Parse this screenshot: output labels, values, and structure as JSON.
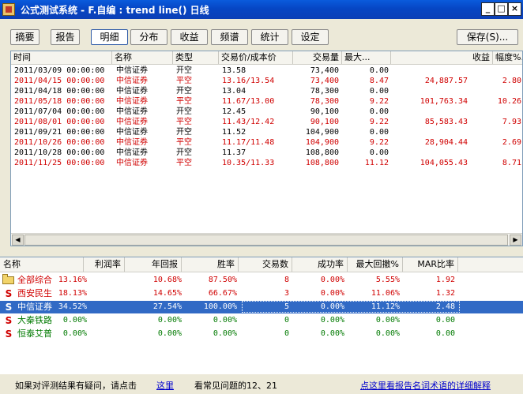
{
  "window": {
    "title": "公式测试系统 - F.自编 : trend line() 日线",
    "minimize": "_",
    "maximize": "□",
    "close": "×"
  },
  "tabs": [
    {
      "label": "摘要",
      "active": false
    },
    {
      "label": "报告",
      "active": false
    },
    {
      "label": "明细",
      "active": true
    },
    {
      "label": "分布",
      "active": false
    },
    {
      "label": "收益",
      "active": false
    },
    {
      "label": "频谱",
      "active": false
    },
    {
      "label": "统计",
      "active": false
    },
    {
      "label": "设定",
      "active": false
    }
  ],
  "save_label": "保存(S)...",
  "detail": {
    "columns": [
      "时间",
      "名称",
      "类型",
      "交易价/成本价",
      "交易量",
      "最大...",
      "收益",
      "幅度%..."
    ],
    "rows": [
      {
        "time": "2011/03/09 00:00:00",
        "name": "中信证券",
        "type": "开空",
        "price": "13.58",
        "volume": "73,400",
        "max": "0.00",
        "profit": "",
        "range": "",
        "red": false
      },
      {
        "time": "2011/04/15 00:00:00",
        "name": "中信证券",
        "type": "平空",
        "price": "13.16/13.54",
        "volume": "73,400",
        "max": "8.47",
        "profit": "24,887.57",
        "range": "2.80",
        "red": true
      },
      {
        "time": "2011/04/18 00:00:00",
        "name": "中信证券",
        "type": "开空",
        "price": "13.04",
        "volume": "78,300",
        "max": "0.00",
        "profit": "",
        "range": "",
        "red": false
      },
      {
        "time": "2011/05/18 00:00:00",
        "name": "中信证券",
        "type": "平空",
        "price": "11.67/13.00",
        "volume": "78,300",
        "max": "9.22",
        "profit": "101,763.34",
        "range": "10.26",
        "red": true
      },
      {
        "time": "2011/07/04 00:00:00",
        "name": "中信证券",
        "type": "开空",
        "price": "12.45",
        "volume": "90,100",
        "max": "0.00",
        "profit": "",
        "range": "",
        "red": false
      },
      {
        "time": "2011/08/01 00:00:00",
        "name": "中信证券",
        "type": "平空",
        "price": "11.43/12.42",
        "volume": "90,100",
        "max": "9.22",
        "profit": "85,583.43",
        "range": "7.93",
        "red": true
      },
      {
        "time": "2011/09/21 00:00:00",
        "name": "中信证券",
        "type": "开空",
        "price": "11.52",
        "volume": "104,900",
        "max": "0.00",
        "profit": "",
        "range": "",
        "red": false
      },
      {
        "time": "2011/10/26 00:00:00",
        "name": "中信证券",
        "type": "平空",
        "price": "11.17/11.48",
        "volume": "104,900",
        "max": "9.22",
        "profit": "28,904.44",
        "range": "2.69",
        "red": true
      },
      {
        "time": "2011/10/28 00:00:00",
        "name": "中信证券",
        "type": "开空",
        "price": "11.37",
        "volume": "108,800",
        "max": "0.00",
        "profit": "",
        "range": "",
        "red": false
      },
      {
        "time": "2011/11/25 00:00:00",
        "name": "中信证券",
        "type": "平空",
        "price": "10.35/11.33",
        "volume": "108,800",
        "max": "11.12",
        "profit": "104,055.43",
        "range": "8.71",
        "red": true
      }
    ]
  },
  "summary": {
    "columns": [
      "名称",
      "利润率",
      "年回报",
      "胜率",
      "交易数",
      "成功率",
      "最大回撤%",
      "MAR比率"
    ],
    "rows": [
      {
        "icon": "folder",
        "name": "全部综合",
        "profit": "13.16%",
        "annual": "10.68%",
        "win": "87.50%",
        "trades": "8",
        "success": "0.00%",
        "drawdown": "5.55%",
        "mar": "1.92",
        "color": "#d00000",
        "selected": false
      },
      {
        "icon": "S",
        "name": "西安民生",
        "profit": "18.13%",
        "annual": "14.65%",
        "win": "66.67%",
        "trades": "3",
        "success": "0.00%",
        "drawdown": "11.06%",
        "mar": "1.32",
        "color": "#d00000",
        "selected": false
      },
      {
        "icon": "S",
        "name": "中信证券",
        "profit": "34.52%",
        "annual": "27.54%",
        "win": "100.00%",
        "trades": "5",
        "success": "0.00%",
        "drawdown": "11.12%",
        "mar": "2.48",
        "color": "#d00000",
        "selected": true
      },
      {
        "icon": "S",
        "name": "大秦铁路",
        "profit": "0.00%",
        "annual": "0.00%",
        "win": "0.00%",
        "trades": "0",
        "success": "0.00%",
        "drawdown": "0.00%",
        "mar": "0.00",
        "color": "#007a00",
        "selected": false
      },
      {
        "icon": "S",
        "name": "恒泰艾普",
        "profit": "0.00%",
        "annual": "0.00%",
        "win": "0.00%",
        "trades": "0",
        "success": "0.00%",
        "drawdown": "0.00%",
        "mar": "0.00",
        "color": "#007a00",
        "selected": false
      }
    ]
  },
  "status": {
    "hint": "如果对评测结果有疑问，请点击",
    "here": "这里",
    "faq": "看常见问题的12、21",
    "report_link": "点这里看报告名词术语的详细解释"
  }
}
